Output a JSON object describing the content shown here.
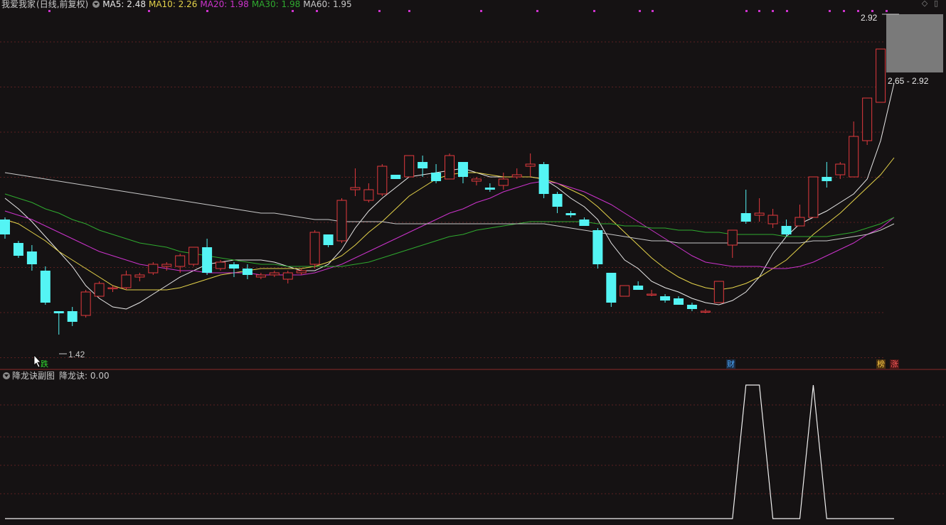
{
  "header": {
    "stock_name": "我爱我家",
    "period": "(日线,前复权)",
    "indicators": [
      {
        "label": "MA5: 2.48",
        "color": "#e8e8e8"
      },
      {
        "label": "MA10: 2.26",
        "color": "#e5d34a"
      },
      {
        "label": "MA20: 1.98",
        "color": "#cc33cc"
      },
      {
        "label": "MA30: 1.98",
        "color": "#2faa2f"
      },
      {
        "label": "MA60: 1.95",
        "color": "#c8c8c8"
      }
    ]
  },
  "sub_header": {
    "title": "降龙诀副图",
    "value_label": "降龙诀: 0.00"
  },
  "markers": {
    "tag_die": "跌",
    "tag_cai": "财",
    "tag_bang": "榜",
    "tag_zhang": "涨"
  },
  "colors": {
    "up": "#e2393e",
    "down": "#54f4f4",
    "background": "#151213",
    "grid": "#5a2020"
  },
  "chart_data": [
    {
      "type": "candlestick",
      "title": "我爱我家 (日线,前复权)",
      "price_range_visible": [
        1.34,
        2.92
      ],
      "annotations": {
        "low_label": "1.42",
        "high_label": "2.92",
        "range_label": "2.65 - 2.92"
      },
      "candles": [
        [
          1.97,
          1.98,
          1.88,
          1.9
        ],
        [
          1.86,
          1.87,
          1.79,
          1.8
        ],
        [
          1.82,
          1.85,
          1.73,
          1.76
        ],
        [
          1.73,
          1.75,
          1.57,
          1.58
        ],
        [
          1.54,
          1.54,
          1.43,
          1.53
        ],
        [
          1.54,
          1.56,
          1.47,
          1.49
        ],
        [
          1.52,
          1.64,
          1.51,
          1.63
        ],
        [
          1.61,
          1.68,
          1.61,
          1.67
        ],
        [
          1.65,
          1.66,
          1.63,
          1.65
        ],
        [
          1.65,
          1.73,
          1.64,
          1.71
        ],
        [
          1.7,
          1.72,
          1.68,
          1.71
        ],
        [
          1.72,
          1.77,
          1.71,
          1.76
        ],
        [
          1.75,
          1.77,
          1.73,
          1.76
        ],
        [
          1.75,
          1.81,
          1.72,
          1.8
        ],
        [
          1.76,
          1.84,
          1.75,
          1.84
        ],
        [
          1.84,
          1.88,
          1.71,
          1.72
        ],
        [
          1.74,
          1.78,
          1.73,
          1.77
        ],
        [
          1.76,
          1.77,
          1.7,
          1.74
        ],
        [
          1.74,
          1.76,
          1.69,
          1.71
        ],
        [
          1.7,
          1.72,
          1.69,
          1.71
        ],
        [
          1.71,
          1.73,
          1.7,
          1.72
        ],
        [
          1.69,
          1.73,
          1.67,
          1.72
        ],
        [
          1.72,
          1.74,
          1.71,
          1.73
        ],
        [
          1.76,
          1.92,
          1.74,
          1.91
        ],
        [
          1.9,
          1.9,
          1.84,
          1.85
        ],
        [
          1.87,
          2.07,
          1.86,
          2.06
        ],
        [
          2.11,
          2.21,
          2.08,
          2.12
        ],
        [
          2.06,
          2.14,
          2.05,
          2.11
        ],
        [
          2.09,
          2.23,
          2.08,
          2.22
        ],
        [
          2.18,
          2.17,
          2.16,
          2.16
        ],
        [
          2.17,
          2.25,
          2.17,
          2.27
        ],
        [
          2.24,
          2.27,
          2.17,
          2.21
        ],
        [
          2.19,
          2.23,
          2.14,
          2.15
        ],
        [
          2.16,
          2.28,
          2.16,
          2.27
        ],
        [
          2.24,
          2.22,
          2.14,
          2.17
        ],
        [
          2.15,
          2.17,
          2.13,
          2.16
        ],
        [
          2.12,
          2.14,
          2.1,
          2.11
        ],
        [
          2.13,
          2.19,
          2.11,
          2.16
        ],
        [
          2.17,
          2.21,
          2.16,
          2.18
        ],
        [
          2.22,
          2.28,
          2.17,
          2.23
        ],
        [
          2.23,
          2.24,
          2.07,
          2.09
        ],
        [
          2.09,
          2.1,
          2.0,
          2.03
        ],
        [
          2.0,
          2.01,
          1.98,
          1.99
        ],
        [
          1.97,
          1.98,
          1.94,
          1.94
        ],
        [
          1.92,
          1.93,
          1.74,
          1.76
        ],
        [
          1.72,
          1.72,
          1.56,
          1.58
        ],
        [
          1.61,
          1.65,
          1.61,
          1.66
        ],
        [
          1.66,
          1.68,
          1.64,
          1.64
        ],
        [
          1.62,
          1.64,
          1.61,
          1.62
        ],
        [
          1.61,
          1.62,
          1.58,
          1.59
        ],
        [
          1.6,
          1.61,
          1.57,
          1.57
        ],
        [
          1.57,
          1.58,
          1.54,
          1.55
        ],
        [
          1.54,
          1.55,
          1.53,
          1.54
        ],
        [
          1.58,
          1.68,
          1.58,
          1.68
        ],
        [
          1.85,
          1.92,
          1.79,
          1.92
        ],
        [
          2.0,
          2.11,
          1.95,
          1.96
        ],
        [
          1.99,
          2.07,
          1.96,
          2.0
        ],
        [
          1.95,
          2.02,
          1.93,
          1.99
        ],
        [
          1.94,
          1.97,
          1.89,
          1.9
        ],
        [
          1.94,
          2.04,
          1.94,
          1.98
        ],
        [
          1.98,
          2.1,
          1.98,
          2.17
        ],
        [
          2.17,
          2.24,
          2.12,
          2.15
        ],
        [
          2.18,
          2.24,
          2.16,
          2.23
        ],
        [
          2.17,
          2.43,
          2.19,
          2.36
        ],
        [
          2.34,
          2.46,
          2.32,
          2.54
        ],
        [
          2.52,
          2.72,
          2.52,
          2.77
        ]
      ],
      "moving_averages": {
        "MA5": [
          2.07,
          2.02,
          1.96,
          1.89,
          1.82,
          1.75,
          1.66,
          1.6,
          1.56,
          1.55,
          1.58,
          1.62,
          1.66,
          1.7,
          1.73,
          1.76,
          1.77,
          1.78,
          1.78,
          1.78,
          1.77,
          1.75,
          1.73,
          1.73,
          1.76,
          1.83,
          1.93,
          2.01,
          2.07,
          2.12,
          2.17,
          2.18,
          2.19,
          2.2,
          2.21,
          2.19,
          2.17,
          2.17,
          2.17,
          2.17,
          2.16,
          2.12,
          2.07,
          2.03,
          1.97,
          1.86,
          1.78,
          1.74,
          1.68,
          1.65,
          1.63,
          1.6,
          1.58,
          1.57,
          1.59,
          1.63,
          1.7,
          1.81,
          1.89,
          1.95,
          1.98,
          2.01,
          2.05,
          2.09,
          2.16,
          2.34,
          2.61
        ],
        "MA10": [
          1.97,
          1.95,
          1.91,
          1.87,
          1.82,
          1.78,
          1.74,
          1.7,
          1.66,
          1.64,
          1.64,
          1.64,
          1.64,
          1.65,
          1.67,
          1.69,
          1.71,
          1.72,
          1.73,
          1.74,
          1.74,
          1.74,
          1.74,
          1.75,
          1.77,
          1.8,
          1.85,
          1.91,
          1.96,
          2.02,
          2.08,
          2.12,
          2.16,
          2.18,
          2.19,
          2.19,
          2.18,
          2.17,
          2.17,
          2.17,
          2.16,
          2.14,
          2.11,
          2.08,
          2.03,
          1.97,
          1.91,
          1.85,
          1.79,
          1.74,
          1.7,
          1.67,
          1.65,
          1.64,
          1.65,
          1.67,
          1.7,
          1.74,
          1.78,
          1.84,
          1.9,
          1.95,
          2.0,
          2.06,
          2.12,
          2.18,
          2.26
        ],
        "MA20": [
          2.01,
          1.99,
          1.97,
          1.94,
          1.91,
          1.88,
          1.85,
          1.82,
          1.8,
          1.78,
          1.76,
          1.75,
          1.74,
          1.73,
          1.73,
          1.72,
          1.72,
          1.72,
          1.72,
          1.71,
          1.71,
          1.71,
          1.71,
          1.72,
          1.74,
          1.76,
          1.79,
          1.82,
          1.85,
          1.88,
          1.91,
          1.94,
          1.97,
          2.0,
          2.02,
          2.05,
          2.07,
          2.1,
          2.12,
          2.14,
          2.15,
          2.14,
          2.12,
          2.1,
          2.07,
          2.04,
          2.0,
          1.96,
          1.92,
          1.88,
          1.84,
          1.8,
          1.77,
          1.76,
          1.75,
          1.75,
          1.75,
          1.74,
          1.74,
          1.75,
          1.77,
          1.8,
          1.83,
          1.86,
          1.9,
          1.93,
          1.98
        ],
        "MA30": [
          2.09,
          2.07,
          2.05,
          2.02,
          2.0,
          1.97,
          1.95,
          1.92,
          1.9,
          1.88,
          1.86,
          1.85,
          1.84,
          1.82,
          1.81,
          1.8,
          1.79,
          1.78,
          1.77,
          1.76,
          1.76,
          1.75,
          1.75,
          1.75,
          1.75,
          1.75,
          1.76,
          1.77,
          1.79,
          1.81,
          1.83,
          1.85,
          1.87,
          1.89,
          1.9,
          1.92,
          1.93,
          1.94,
          1.95,
          1.96,
          1.96,
          1.96,
          1.96,
          1.96,
          1.95,
          1.95,
          1.94,
          1.94,
          1.93,
          1.93,
          1.92,
          1.92,
          1.91,
          1.91,
          1.9,
          1.9,
          1.9,
          1.9,
          1.89,
          1.89,
          1.89,
          1.89,
          1.9,
          1.91,
          1.93,
          1.95,
          1.98
        ],
        "MA60": [
          2.19,
          2.18,
          2.17,
          2.16,
          2.15,
          2.14,
          2.13,
          2.12,
          2.11,
          2.1,
          2.09,
          2.08,
          2.07,
          2.06,
          2.05,
          2.04,
          2.03,
          2.02,
          2.01,
          2.0,
          2.0,
          1.99,
          1.98,
          1.97,
          1.97,
          1.96,
          1.96,
          1.96,
          1.96,
          1.95,
          1.95,
          1.95,
          1.95,
          1.95,
          1.95,
          1.95,
          1.95,
          1.95,
          1.95,
          1.95,
          1.95,
          1.94,
          1.93,
          1.92,
          1.91,
          1.9,
          1.89,
          1.88,
          1.87,
          1.87,
          1.86,
          1.86,
          1.86,
          1.86,
          1.86,
          1.86,
          1.86,
          1.86,
          1.86,
          1.86,
          1.87,
          1.87,
          1.88,
          1.89,
          1.9,
          1.92,
          1.95
        ]
      }
    },
    {
      "type": "line",
      "title": "降龙诀副图",
      "series": [
        {
          "name": "降龙诀",
          "values": [
            0,
            0,
            0,
            0,
            0,
            0,
            0,
            0,
            0,
            0,
            0,
            0,
            0,
            0,
            0,
            0,
            0,
            0,
            0,
            0,
            0,
            0,
            0,
            0,
            0,
            0,
            0,
            0,
            0,
            0,
            0,
            0,
            0,
            0,
            0,
            0,
            0,
            0,
            0,
            0,
            0,
            0,
            0,
            0,
            0,
            0,
            0,
            0,
            0,
            0,
            0,
            0,
            0,
            0,
            0,
            1,
            1,
            0,
            0,
            0,
            1,
            0,
            0,
            0,
            0,
            0,
            0
          ]
        }
      ]
    }
  ]
}
